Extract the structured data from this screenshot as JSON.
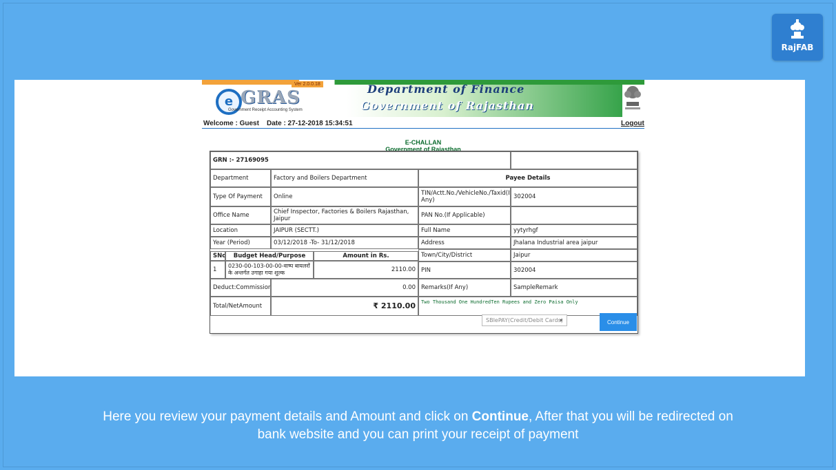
{
  "brand": {
    "badge_text": "RajFAB",
    "icon": "state-emblem-icon"
  },
  "header": {
    "egras_e": "e",
    "egras_word": "GRAS",
    "egras_subtitle": "Government Receipt Accounting System",
    "version": "Ver 2.0.0.18",
    "dept": "Department of Finance",
    "gov": "Government of Rajasthan",
    "welcome": "Welcome : Guest",
    "date": "Date : 27-12-2018 15:34:51",
    "logout": "Logout"
  },
  "challan_title": {
    "line1": "E-CHALLAN",
    "line2": "Government of Rajasthan"
  },
  "challan": {
    "grn": "GRN :- 27169095",
    "payee_header": "Payee Details",
    "left": [
      {
        "label": "Department",
        "value": "Factory and Boilers Department"
      },
      {
        "label": "Type Of Payment",
        "value": "Online"
      },
      {
        "label": "Office Name",
        "value": "Chief Inspector, Factories & Boilers Rajasthan, Jaipur"
      },
      {
        "label": "Location",
        "value": "JAIPUR (SECTT.)"
      },
      {
        "label": "Year   (Period)",
        "value": "03/12/2018 -To- 31/12/2018"
      }
    ],
    "budget": {
      "sno_header": "SNo.",
      "head_header": "Budget Head/Purpose",
      "amount_header": "Amount in Rs.",
      "sno": "1",
      "head": "0230-00-103-00-00-वाष्प बायलरों के अन्तर्गत उगाहा गया शुल्क",
      "amount": "2110.00"
    },
    "deduct_label": "Deduct:Commission",
    "deduct_value": "0.00",
    "total_label": "Total/NetAmount",
    "total_value": "₹ 2110.00",
    "right": [
      {
        "label": "TIN/Actt.No./VehicleNo./Taxid(If Any)",
        "value": "302004"
      },
      {
        "label": "PAN No.(If Applicable)",
        "value": ""
      },
      {
        "label": "Full Name",
        "value": "yytyrhgf"
      },
      {
        "label": "Address",
        "value": "Jhalana Industrial area jaipur"
      },
      {
        "label": "Town/City/District",
        "value": "Jaipur"
      },
      {
        "label": "PIN",
        "value": "302004"
      },
      {
        "label": "Remarks(If Any)",
        "value": "SampleRemark"
      }
    ],
    "amount_words": "Two Thousand One HundredTen Rupees  and Zero Paisa Only",
    "payment_select": "SBIePAY(Credit/Debit Cards)",
    "continue_label": "Continue"
  },
  "caption": {
    "part1": "Here you review your payment details and Amount and click on ",
    "bold": "Continue",
    "part2": ", After that you will be redirected on",
    "line2": "bank website and you can print your receipt of payment"
  }
}
